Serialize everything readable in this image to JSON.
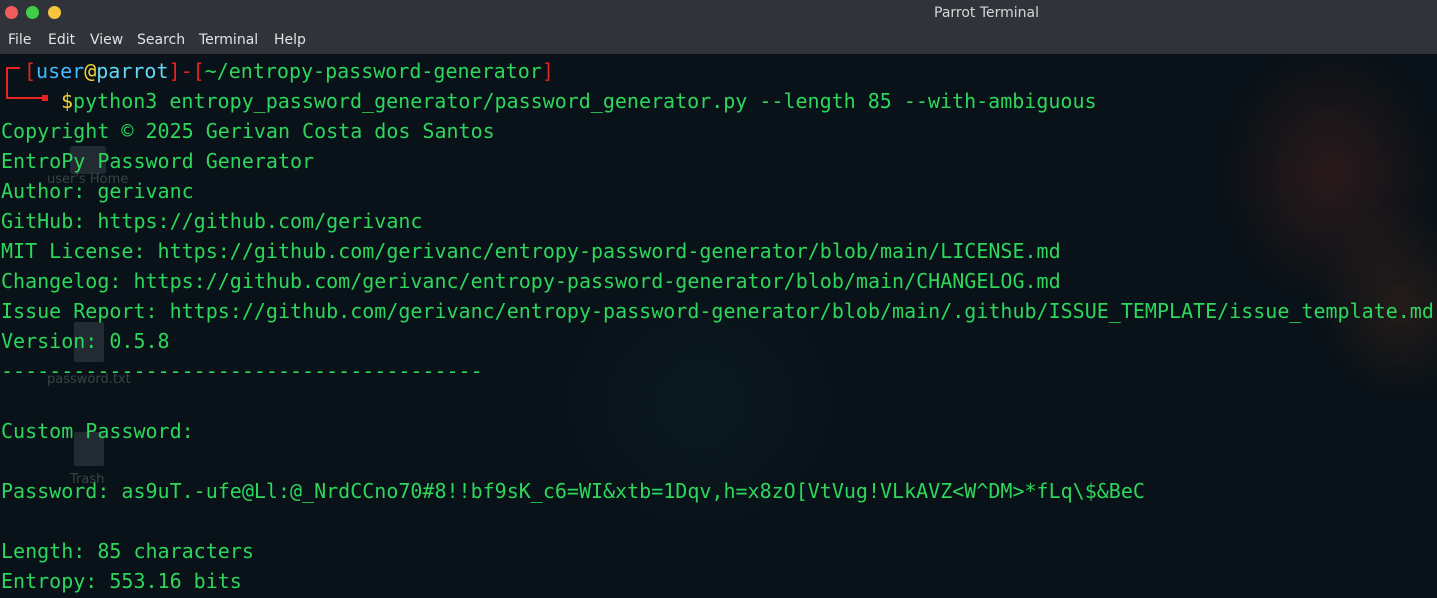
{
  "window": {
    "title": "Parrot Terminal"
  },
  "menu": [
    {
      "label": "File"
    },
    {
      "label": "Edit"
    },
    {
      "label": "View"
    },
    {
      "label": "Search"
    },
    {
      "label": "Terminal"
    },
    {
      "label": "Help"
    }
  ],
  "prompt": {
    "open_bracket_1": "[",
    "user": "user",
    "at": "@",
    "host": "parrot",
    "close_bracket_1": "]",
    "dash": "-",
    "open_bracket_2": "[",
    "directory": "~/entropy-password-generator",
    "close_bracket_2": "]",
    "dollar": "$",
    "command": "python3 entropy_password_generator/password_generator.py --length 85 --with-ambiguous"
  },
  "output": {
    "copyright": "Copyright © 2025 Gerivan Costa dos Santos",
    "app_name": "EntroPy Password Generator",
    "author": "Author: gerivanc",
    "github": "GitHub: https://github.com/gerivanc",
    "license": "MIT License: https://github.com/gerivanc/entropy-password-generator/blob/main/LICENSE.md",
    "changelog": "Changelog: https://github.com/gerivanc/entropy-password-generator/blob/main/CHANGELOG.md",
    "issue_report": "Issue Report: https://github.com/gerivanc/entropy-password-generator/blob/main/.github/ISSUE_TEMPLATE/issue_template.md",
    "version": "Version: 0.5.8",
    "separator": "----------------------------------------",
    "section": "Custom Password:",
    "password": "Password: as9uT.-ufe@Ll:@_NrdCCno70#8!!bf9sK_c6=WI&xtb=1Dqv,h=x8zO[VtVug!VLkAVZ<W^DM>*fLq\\$&BeC",
    "length": "Length: 85 characters",
    "entropy": "Entropy: 553.16 bits"
  },
  "desktop": {
    "labels": [
      "user's Home",
      "password.txt",
      "Trash"
    ]
  },
  "colors": {
    "terminal_green": "#2ed65b",
    "prompt_red": "#e8231f",
    "prompt_yellow": "#f4d436",
    "prompt_cyan": "#63d8f5",
    "background": "#081218",
    "chrome": "#30343a"
  }
}
